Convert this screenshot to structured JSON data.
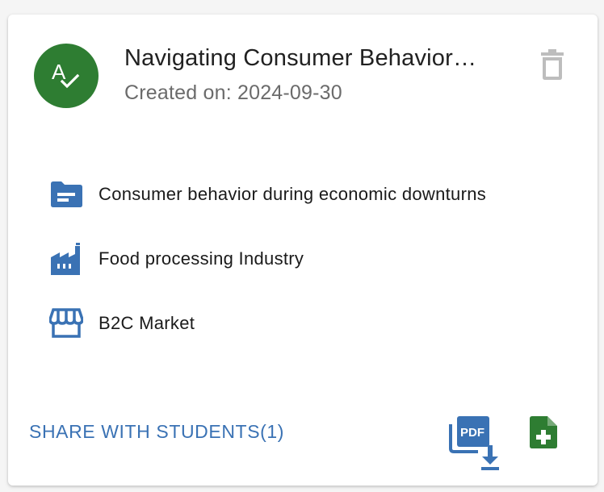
{
  "card": {
    "title": "Navigating Consumer Behavior…",
    "created_label": "Created on: 2024-09-30",
    "avatar_icon": "spellcheck-icon",
    "avatar_color": "#2e7d32",
    "accent_color": "#3a72b4"
  },
  "details": [
    {
      "icon": "folder-icon",
      "text": "Consumer behavior during economic downturns"
    },
    {
      "icon": "factory-icon",
      "text": "Food processing Industry"
    },
    {
      "icon": "storefront-icon",
      "text": "B2C Market"
    }
  ],
  "actions": {
    "share_label": "SHARE WITH STUDENTS(1)",
    "pdf_icon_text": "PDF",
    "pdf_icon": "pdf-download-icon",
    "add_doc_icon": "note-add-icon",
    "delete_icon": "trash-icon"
  }
}
